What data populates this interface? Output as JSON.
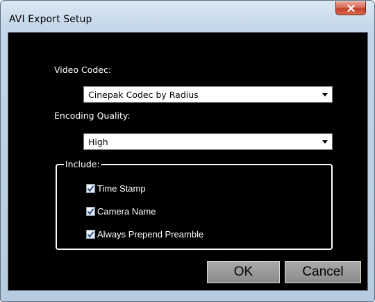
{
  "window": {
    "title": "AVI Export Setup",
    "close_icon": "close-icon"
  },
  "video_codec": {
    "label": "Video Codec:",
    "selected": "Cinepak Codec by Radius"
  },
  "encoding_quality": {
    "label": "Encoding Quality:",
    "selected": "High"
  },
  "include": {
    "legend": "Include:",
    "options": [
      {
        "label": "Time Stamp",
        "checked": true
      },
      {
        "label": "Camera Name",
        "checked": true
      },
      {
        "label": "Always Prepend Preamble",
        "checked": true
      }
    ]
  },
  "buttons": {
    "ok_label": "OK",
    "cancel_label": "Cancel"
  },
  "colors": {
    "content_background": "#000000",
    "close_button": "#c0412a",
    "check_mark": "#2b4f8c"
  }
}
